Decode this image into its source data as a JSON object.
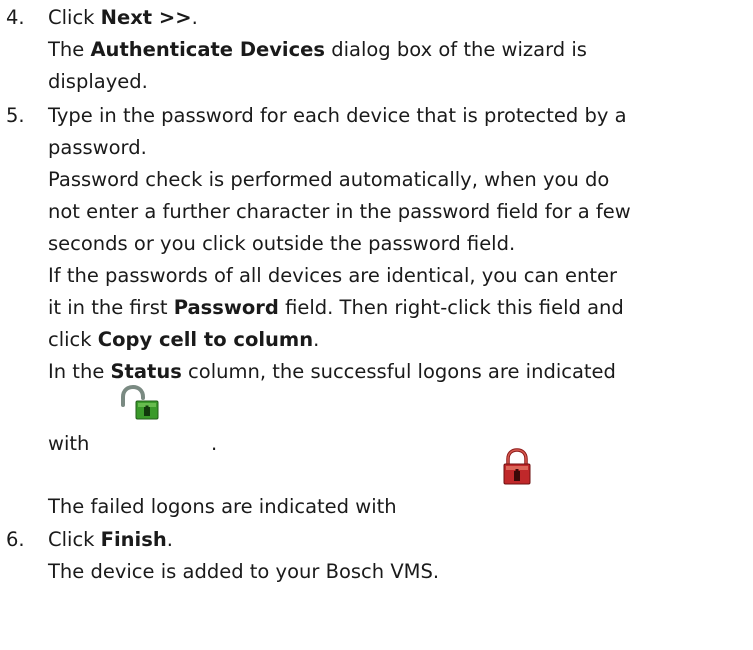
{
  "steps": [
    {
      "number": "4.",
      "instruction_prefix": "Click ",
      "instruction_bold": "Next >>",
      "instruction_suffix": ".",
      "result_prefix": "The ",
      "result_bold": "Authenticate Devices",
      "result_suffix": " dialog box of the wizard is",
      "result_cont": "displayed."
    },
    {
      "number": "5.",
      "line1": "Type in the password for each device that is protected by a",
      "line2": "password.",
      "line3": "Password check is performed automatically, when you do",
      "line4": "not enter a further character in the password field for a few",
      "line5": "seconds or you click outside the password field.",
      "line6": "If the passwords of all devices are identical, you can enter",
      "line7_prefix": "it in the first ",
      "line7_bold": "Password",
      "line7_suffix": " field. Then right-click this field and",
      "line8_prefix": "click ",
      "line8_bold": "Copy cell to column",
      "line8_suffix": ".",
      "line9_prefix": "In the ",
      "line9_bold": "Status",
      "line9_suffix": " column, the successful logons are indicated",
      "line10_prefix": "with",
      "line10_suffix": ".",
      "line11": "The failed logons are indicated with",
      "success_icon": "unlocked-padlock-icon",
      "failed_icon": "locked-padlock-icon"
    },
    {
      "number": "6.",
      "instruction_prefix": "Click ",
      "instruction_bold": "Finish",
      "instruction_suffix": ".",
      "result": "The device is added to your Bosch VMS."
    }
  ],
  "colors": {
    "text": "#1a1a1a",
    "icon_green": "#3a9a2a",
    "icon_red": "#c0282a",
    "icon_shackle": "#7a8a82"
  }
}
